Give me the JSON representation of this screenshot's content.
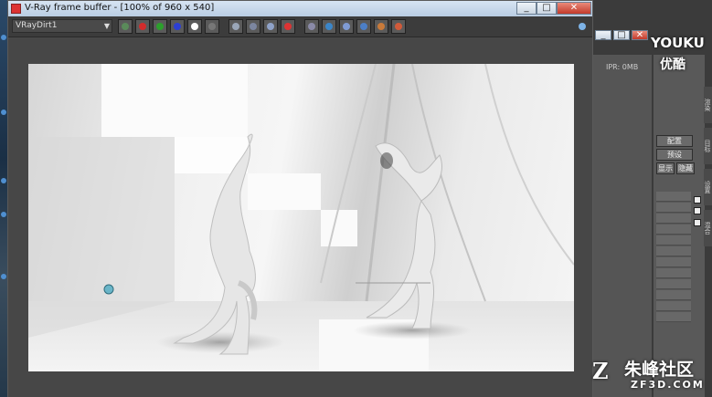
{
  "window": {
    "title": "V-Ray frame buffer - [100% of 960 x 540]",
    "controls": [
      "_",
      "□",
      "✕"
    ]
  },
  "toolbar": {
    "channel_select": "VRayDirt1",
    "buttons": [
      {
        "name": "rgb-channel-button",
        "color": "#5a8a5a"
      },
      {
        "name": "red-channel-button",
        "color": "#d22c2c"
      },
      {
        "name": "green-channel-button",
        "color": "#2ca02c"
      },
      {
        "name": "blue-channel-button",
        "color": "#2c3fd2"
      },
      {
        "name": "alpha-channel-button",
        "color": "#ffffff"
      },
      {
        "name": "mono-button",
        "color": "#777777"
      },
      {
        "name": "save-button",
        "color": "#9aa6b8"
      },
      {
        "name": "save-all-button",
        "color": "#7c86a0"
      },
      {
        "name": "load-button",
        "color": "#8fa2c8"
      },
      {
        "name": "clear-button",
        "color": "#d33"
      },
      {
        "name": "track-mouse-button",
        "color": "#8a8aa8"
      },
      {
        "name": "region-button",
        "color": "#3b86c9"
      },
      {
        "name": "duplicate-button",
        "color": "#7f9bd3"
      },
      {
        "name": "render-region-button",
        "color": "#4c7fc6"
      },
      {
        "name": "color-correction-button",
        "color": "#c87a3a"
      },
      {
        "name": "render-last-button",
        "color": "#d05a3a"
      }
    ]
  },
  "side_panel": {
    "ipr_label": "IPR: 0MB",
    "buttons": [
      "配置",
      "预设",
      "显示",
      "隐藏"
    ],
    "tabs": [
      "渲染",
      "目标",
      "设置",
      "混合"
    ]
  },
  "watermarks": {
    "youku": "YOUKU",
    "youku_cn": "优酷",
    "zf3d": "朱峰社区",
    "zf3d_url": "ZF3D.COM"
  },
  "colors": {
    "accent": "#3b86c9",
    "titlebar": "#c8d8ea"
  }
}
